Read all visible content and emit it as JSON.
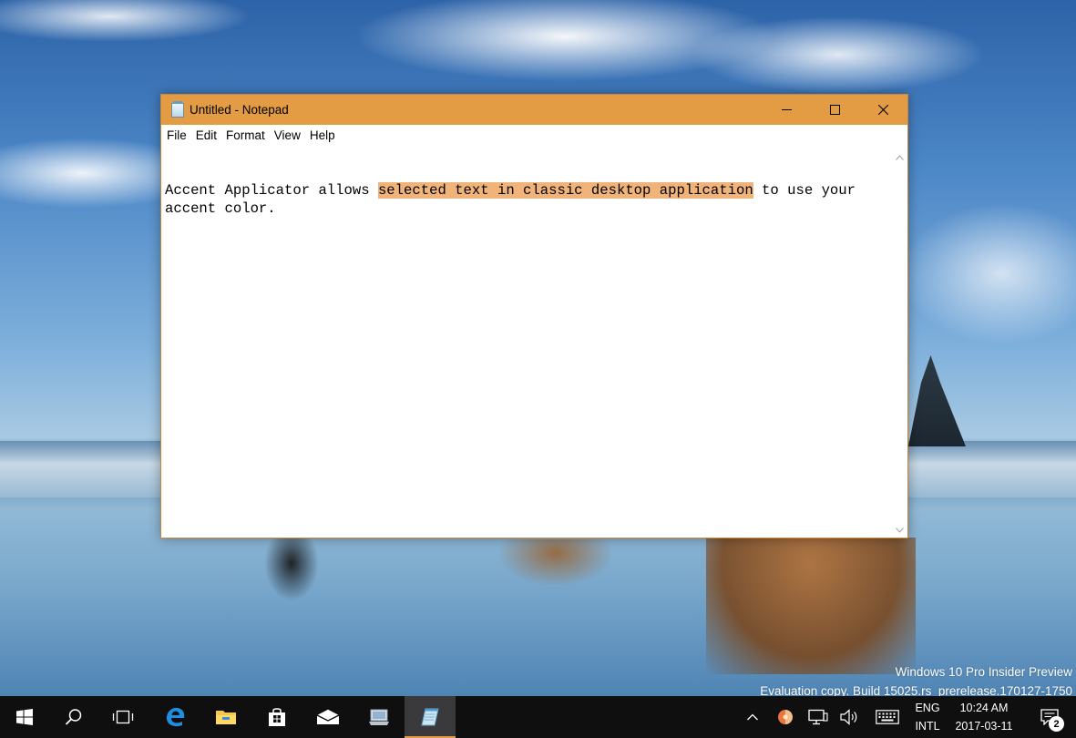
{
  "window": {
    "title": "Untitled - Notepad",
    "accent_color": "#e39c44",
    "selection_color": "#f0b47a"
  },
  "menu": {
    "items": [
      "File",
      "Edit",
      "Format",
      "View",
      "Help"
    ]
  },
  "document": {
    "text_before": "Accent Applicator allows ",
    "text_selected": "selected text in classic desktop application",
    "text_after": " to use your accent color."
  },
  "watermark": {
    "line1": "Windows 10 Pro Insider Preview",
    "line2": "Evaluation copy. Build 15025.rs_prerelease.170127-1750"
  },
  "taskbar": {
    "apps": [
      "start-icon",
      "search-icon",
      "task-view-icon",
      "edge-icon",
      "file-explorer-icon",
      "store-icon",
      "mail-icon",
      "devices-icon",
      "notepad-icon"
    ],
    "active_app": "notepad-icon",
    "tray": {
      "lang_line1": "ENG",
      "lang_line2": "INTL",
      "time": "10:24 AM",
      "date": "2017-03-11",
      "notification_count": "2"
    }
  }
}
